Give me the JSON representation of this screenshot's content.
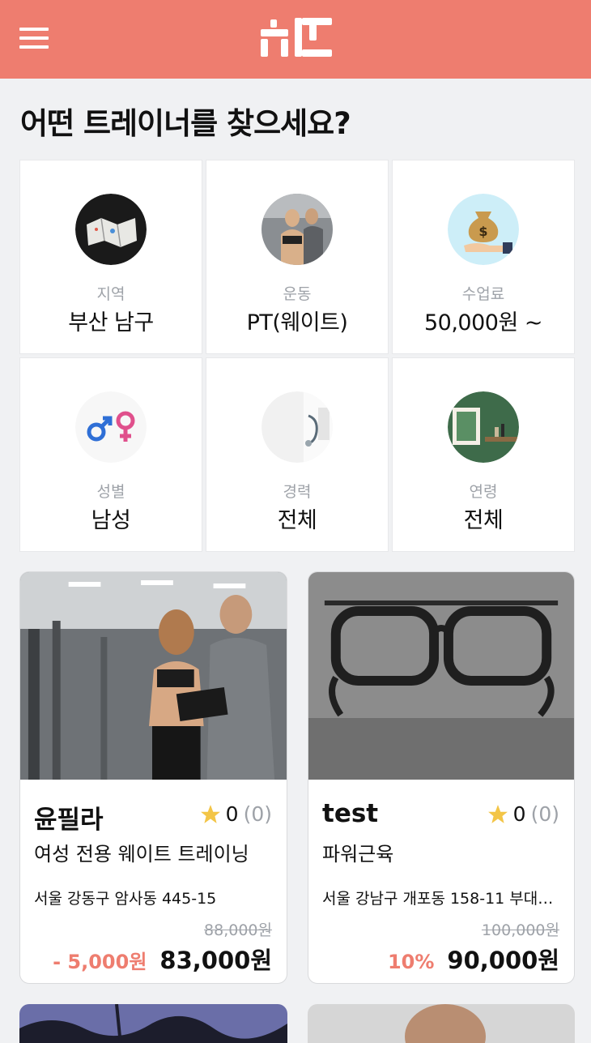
{
  "header": {
    "menu_icon": "hamburger-icon",
    "logo_icon": "brand-logo",
    "accent_color": "#ee7d6f"
  },
  "question": "어떤 트레이너를 찾으세요?",
  "filters": [
    {
      "label": "지역",
      "value": "부산 남구",
      "icon": "map-icon"
    },
    {
      "label": "운동",
      "value": "PT(웨이트)",
      "icon": "workout-photo"
    },
    {
      "label": "수업료",
      "value": "50,000원 ~",
      "icon": "money-bag-icon"
    },
    {
      "label": "성별",
      "value": "남성",
      "icon": "gender-icon"
    },
    {
      "label": "경력",
      "value": "전체",
      "icon": "career-photo"
    },
    {
      "label": "연령",
      "value": "전체",
      "icon": "age-photo"
    }
  ],
  "cards": [
    {
      "name": "윤필라",
      "rating": "0",
      "rating_count": "(0)",
      "subtitle": "여성 전용 웨이트 트레이닝",
      "address": "서울 강동구 암사동 445-15",
      "original_price": "88,000원",
      "discount": "- 5,000원",
      "price": "83,000원"
    },
    {
      "name": "test",
      "rating": "0",
      "rating_count": "(0)",
      "subtitle": "파워근육",
      "address": "서울 강남구 개포동 158-11 부대…",
      "original_price": "100,000원",
      "discount": "10%",
      "price": "90,000원"
    }
  ]
}
